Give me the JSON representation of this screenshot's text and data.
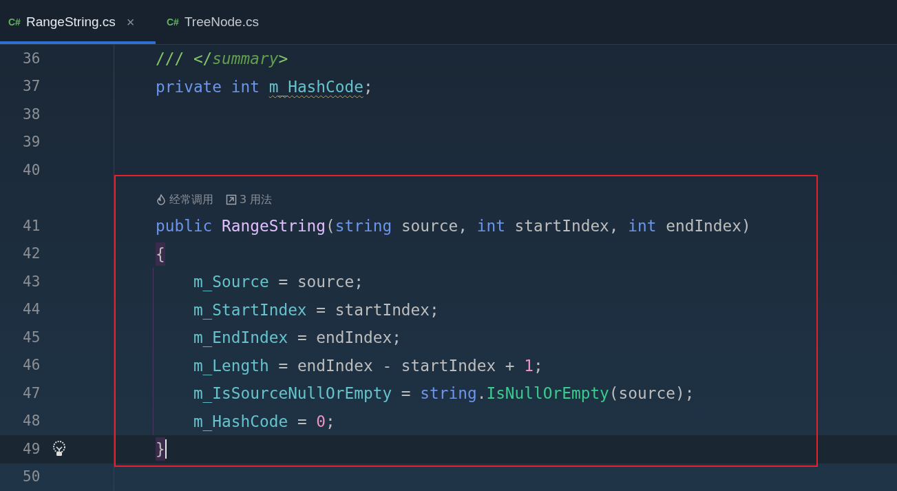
{
  "tabs": [
    {
      "lang": "C#",
      "label": "RangeString.cs",
      "close": "×",
      "selected": true
    },
    {
      "lang": "C#",
      "label": "TreeNode.cs",
      "selected": false
    }
  ],
  "annotation_box": {
    "color": "#e8202a"
  },
  "lines": [
    {
      "number": "36",
      "tokens": [
        {
          "text": "/// </",
          "kind": "comment"
        },
        {
          "text": "summary",
          "kind": "doctag"
        },
        {
          "text": ">",
          "kind": "comment"
        }
      ]
    },
    {
      "number": "37",
      "tokens": [
        {
          "text": "private int ",
          "kind": "keyword"
        },
        {
          "text": "m_HashCode",
          "kind": "field",
          "warning": true
        },
        {
          "text": ";",
          "kind": "plain"
        }
      ]
    },
    {
      "number": "38"
    },
    {
      "number": "39"
    },
    {
      "number": "40"
    },
    {
      "kind": "hint",
      "hints": [
        {
          "kind": "flame",
          "text": "经常调用"
        },
        {
          "kind": "usages",
          "text": "3 用法"
        }
      ]
    },
    {
      "number": "41",
      "tokens": [
        {
          "text": "public ",
          "kind": "keyword"
        },
        {
          "text": "RangeString",
          "kind": "class"
        },
        {
          "text": "(",
          "kind": "plain"
        },
        {
          "text": "string ",
          "kind": "keyword"
        },
        {
          "text": "source, ",
          "kind": "plain"
        },
        {
          "text": "int ",
          "kind": "keyword"
        },
        {
          "text": "startIndex, ",
          "kind": "plain"
        },
        {
          "text": "int ",
          "kind": "keyword"
        },
        {
          "text": "endIndex)",
          "kind": "plain"
        }
      ]
    },
    {
      "number": "42",
      "tokens": [
        {
          "text": "{",
          "kind": "plain",
          "matched": true
        }
      ]
    },
    {
      "number": "43",
      "tokens": [
        {
          "text": "    m_Source",
          "kind": "field"
        },
        {
          "text": " = source;",
          "kind": "plain"
        }
      ]
    },
    {
      "number": "44",
      "tokens": [
        {
          "text": "    m_StartIndex",
          "kind": "field"
        },
        {
          "text": " = startIndex;",
          "kind": "plain"
        }
      ]
    },
    {
      "number": "45",
      "tokens": [
        {
          "text": "    m_EndIndex",
          "kind": "field"
        },
        {
          "text": " = endIndex;",
          "kind": "plain"
        }
      ]
    },
    {
      "number": "46",
      "tokens": [
        {
          "text": "    m_Length",
          "kind": "field"
        },
        {
          "text": " = endIndex - startIndex + ",
          "kind": "plain"
        },
        {
          "text": "1",
          "kind": "number"
        },
        {
          "text": ";",
          "kind": "plain"
        }
      ]
    },
    {
      "number": "47",
      "tokens": [
        {
          "text": "    m_IsSourceNullOrEmpty",
          "kind": "field"
        },
        {
          "text": " = ",
          "kind": "plain"
        },
        {
          "text": "string",
          "kind": "keyword"
        },
        {
          "text": ".",
          "kind": "plain"
        },
        {
          "text": "IsNullOrEmpty",
          "kind": "method"
        },
        {
          "text": "(source);",
          "kind": "plain"
        }
      ]
    },
    {
      "number": "48",
      "tokens": [
        {
          "text": "    m_HashCode",
          "kind": "field"
        },
        {
          "text": " = ",
          "kind": "plain"
        },
        {
          "text": "0",
          "kind": "number"
        },
        {
          "text": ";",
          "kind": "plain"
        }
      ]
    },
    {
      "number": "49",
      "current": true,
      "bulb": true,
      "caret": true,
      "tokens": [
        {
          "text": "}",
          "kind": "plain",
          "matched": true
        }
      ]
    },
    {
      "number": "50"
    }
  ]
}
